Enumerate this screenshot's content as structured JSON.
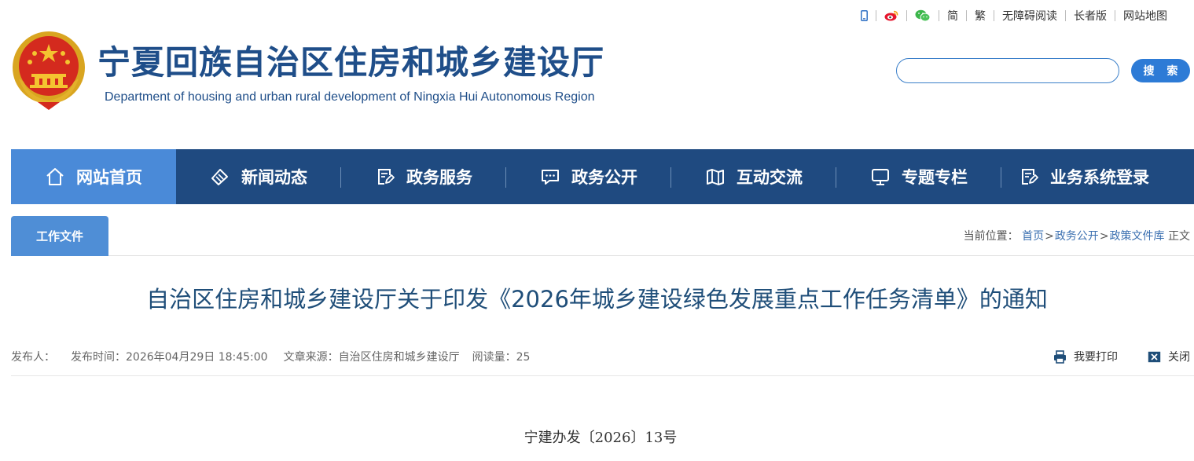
{
  "header": {
    "site_title": "宁夏回族自治区住房和城乡建设厅",
    "site_subtitle": "Department of housing and urban rural development of Ningxia Hui Autonomous Region",
    "toplinks": {
      "simplified": "简",
      "traditional": "繁",
      "accessible": "无障碍阅读",
      "elderly": "长者版",
      "sitemap": "网站地图"
    },
    "search": {
      "placeholder": "",
      "button_label": "搜 索"
    }
  },
  "nav": {
    "items": [
      {
        "label": "网站首页",
        "icon": "home-icon",
        "active": true
      },
      {
        "label": "新闻动态",
        "icon": "tag-icon"
      },
      {
        "label": "政务服务",
        "icon": "edit-document-icon"
      },
      {
        "label": "政务公开",
        "icon": "chat-icon"
      },
      {
        "label": "互动交流",
        "icon": "map-icon"
      },
      {
        "label": "专题专栏",
        "icon": "monitor-icon"
      },
      {
        "label": "业务系统登录",
        "icon": "edit-document-icon"
      }
    ]
  },
  "section": {
    "tab_label": "工作文件",
    "breadcrumb": {
      "prefix": "当前位置：",
      "items": [
        "首页",
        "政务公开",
        "政策文件库"
      ],
      "separator": ">",
      "current": "正文"
    }
  },
  "article": {
    "title": "自治区住房和城乡建设厅关于印发《2026年城乡建设绿色发展重点工作任务清单》的通知",
    "meta": {
      "publisher_label": "发布人：",
      "publisher_value": "",
      "time_label": "发布时间：",
      "time_value": "2026年04月29日 18:45:00",
      "source_label": "文章来源：",
      "source_value": "自治区住房和城乡建设厅",
      "reads_label": "阅读量：",
      "reads_value": "25"
    },
    "actions": {
      "print": "我要打印",
      "close": "关闭"
    },
    "doc_number": "宁建办发〔2026〕13号"
  },
  "colors": {
    "brand_blue": "#1f4e89",
    "nav_bg": "#1f4a80",
    "nav_active": "#4a8ad8",
    "search_button": "#2d7bd6",
    "title_text": "#1f4e79"
  }
}
